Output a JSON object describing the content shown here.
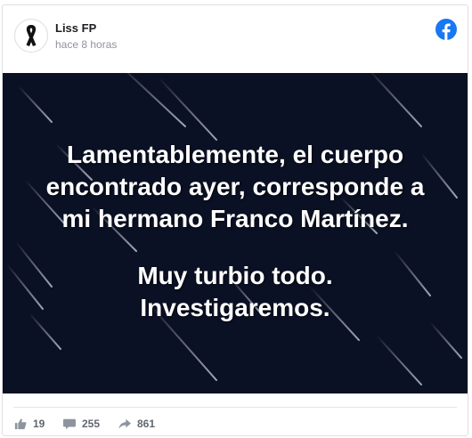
{
  "post": {
    "author": "Liss FP",
    "time": "hace 8 horas",
    "avatar_icon": "black-ribbon-icon",
    "platform_icon": "facebook-logo-icon",
    "lines": [
      "Lamentablemente, el cuerpo",
      "encontrado ayer, corresponde a",
      "mi hermano Franco Martínez.",
      "Muy turbio todo.",
      "Investigaremos."
    ]
  },
  "stats": {
    "likes": "19",
    "comments": "255",
    "shares": "861"
  },
  "colors": {
    "brand": "#1877f2",
    "image_background": "#0b1124",
    "text": "#1c1e21",
    "muted": "#90949c"
  }
}
